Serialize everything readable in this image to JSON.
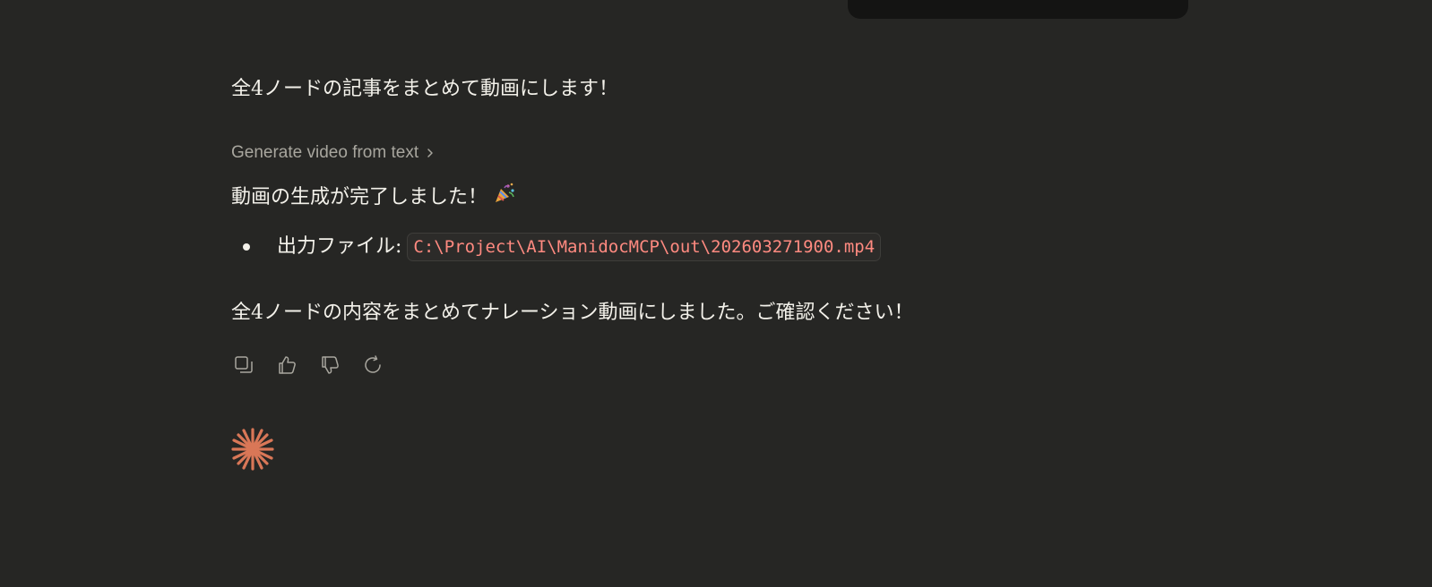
{
  "messages": {
    "intro_text": "全4ノードの記事をまとめて動画にします！",
    "tool_call_label": "Generate video from text",
    "done_text": "動画の生成が完了しました！",
    "output_label": "出力ファイル:",
    "output_path": "C:\\Project\\AI\\ManidocMCP\\out\\202603271900.mp4",
    "closing_text": "全4ノードの内容をまとめてナレーション動画にしました。ご確認ください！"
  },
  "icons": {
    "tool_chevron": "chevron-right-icon",
    "celebration": "party-popper-icon",
    "copy": "copy-icon",
    "like": "thumbs-up-icon",
    "dislike": "thumbs-down-icon",
    "retry": "retry-icon",
    "assistant_mark": "claude-spark-icon"
  },
  "colors": {
    "background": "#262624",
    "text": "#f3f1ea",
    "muted": "#a8a69e",
    "code_text": "#ff8a80",
    "accent": "#d97757"
  }
}
